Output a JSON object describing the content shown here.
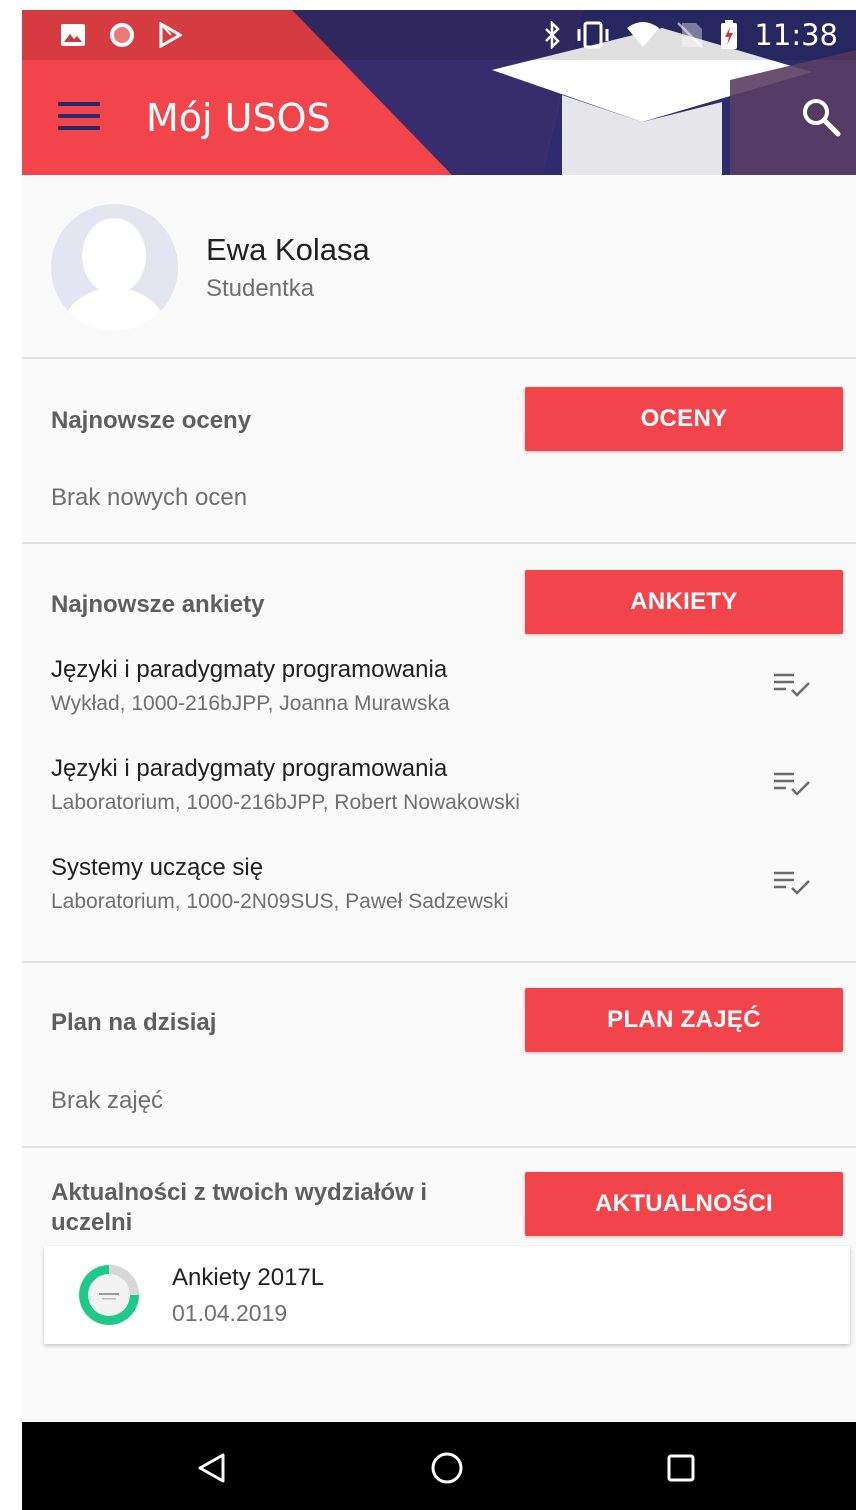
{
  "status_bar": {
    "time": "11:38",
    "left_icons": [
      "image-icon",
      "app-icon",
      "play-store-icon"
    ],
    "right_icons": [
      "bluetooth-icon",
      "vibrate-icon",
      "wifi-icon",
      "no-sim-icon",
      "battery-charging-icon"
    ]
  },
  "app_bar": {
    "title": "Mój USOS",
    "menu_icon": "hamburger-menu-icon",
    "search_icon": "search-icon"
  },
  "profile": {
    "name": "Ewa Kolasa",
    "role": "Studentka"
  },
  "grades": {
    "title": "Najnowsze oceny",
    "button": "OCENY",
    "empty": "Brak nowych ocen"
  },
  "surveys": {
    "title": "Najnowsze ankiety",
    "button": "ANKIETY",
    "items": [
      {
        "title": "Języki i paradygmaty programowania",
        "subtitle": "Wykład, 1000-216bJPP, Joanna Murawska"
      },
      {
        "title": "Języki i paradygmaty programowania",
        "subtitle": "Laboratorium, 1000-216bJPP, Robert Nowakowski"
      },
      {
        "title": "Systemy uczące się",
        "subtitle": "Laboratorium, 1000-2N09SUS, Paweł Sadzewski"
      }
    ]
  },
  "schedule": {
    "title": "Plan na dzisiaj",
    "button": "PLAN ZAJĘĆ",
    "empty": "Brak zajęć"
  },
  "news": {
    "title": "Aktualności z twoich wydziałów i uczelni",
    "button": "AKTUALNOŚCI",
    "items": [
      {
        "title": "Ankiety 2017L",
        "date": "01.04.2019"
      }
    ]
  },
  "colors": {
    "accent": "#f2454b",
    "navy": "#2a2a6a",
    "survey_green": "#1fc989"
  }
}
